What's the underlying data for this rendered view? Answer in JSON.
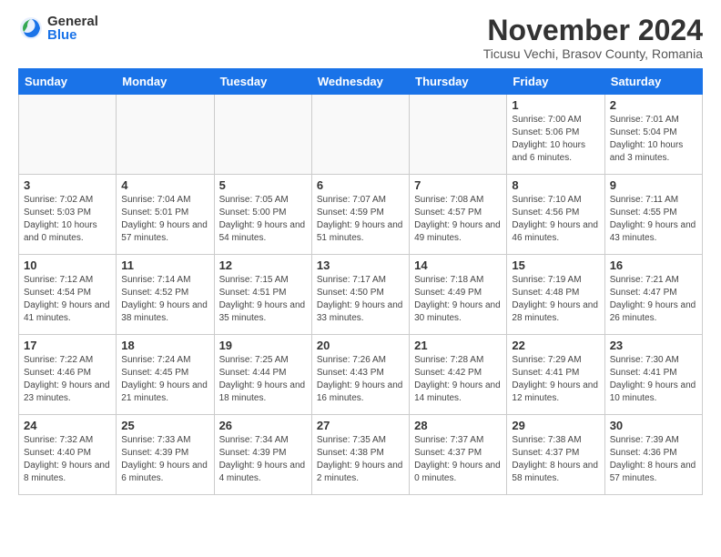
{
  "logo": {
    "general": "General",
    "blue": "Blue"
  },
  "header": {
    "month": "November 2024",
    "location": "Ticusu Vechi, Brasov County, Romania"
  },
  "weekdays": [
    "Sunday",
    "Monday",
    "Tuesday",
    "Wednesday",
    "Thursday",
    "Friday",
    "Saturday"
  ],
  "weeks": [
    [
      {
        "day": "",
        "info": ""
      },
      {
        "day": "",
        "info": ""
      },
      {
        "day": "",
        "info": ""
      },
      {
        "day": "",
        "info": ""
      },
      {
        "day": "",
        "info": ""
      },
      {
        "day": "1",
        "info": "Sunrise: 7:00 AM\nSunset: 5:06 PM\nDaylight: 10 hours and 6 minutes."
      },
      {
        "day": "2",
        "info": "Sunrise: 7:01 AM\nSunset: 5:04 PM\nDaylight: 10 hours and 3 minutes."
      }
    ],
    [
      {
        "day": "3",
        "info": "Sunrise: 7:02 AM\nSunset: 5:03 PM\nDaylight: 10 hours and 0 minutes."
      },
      {
        "day": "4",
        "info": "Sunrise: 7:04 AM\nSunset: 5:01 PM\nDaylight: 9 hours and 57 minutes."
      },
      {
        "day": "5",
        "info": "Sunrise: 7:05 AM\nSunset: 5:00 PM\nDaylight: 9 hours and 54 minutes."
      },
      {
        "day": "6",
        "info": "Sunrise: 7:07 AM\nSunset: 4:59 PM\nDaylight: 9 hours and 51 minutes."
      },
      {
        "day": "7",
        "info": "Sunrise: 7:08 AM\nSunset: 4:57 PM\nDaylight: 9 hours and 49 minutes."
      },
      {
        "day": "8",
        "info": "Sunrise: 7:10 AM\nSunset: 4:56 PM\nDaylight: 9 hours and 46 minutes."
      },
      {
        "day": "9",
        "info": "Sunrise: 7:11 AM\nSunset: 4:55 PM\nDaylight: 9 hours and 43 minutes."
      }
    ],
    [
      {
        "day": "10",
        "info": "Sunrise: 7:12 AM\nSunset: 4:54 PM\nDaylight: 9 hours and 41 minutes."
      },
      {
        "day": "11",
        "info": "Sunrise: 7:14 AM\nSunset: 4:52 PM\nDaylight: 9 hours and 38 minutes."
      },
      {
        "day": "12",
        "info": "Sunrise: 7:15 AM\nSunset: 4:51 PM\nDaylight: 9 hours and 35 minutes."
      },
      {
        "day": "13",
        "info": "Sunrise: 7:17 AM\nSunset: 4:50 PM\nDaylight: 9 hours and 33 minutes."
      },
      {
        "day": "14",
        "info": "Sunrise: 7:18 AM\nSunset: 4:49 PM\nDaylight: 9 hours and 30 minutes."
      },
      {
        "day": "15",
        "info": "Sunrise: 7:19 AM\nSunset: 4:48 PM\nDaylight: 9 hours and 28 minutes."
      },
      {
        "day": "16",
        "info": "Sunrise: 7:21 AM\nSunset: 4:47 PM\nDaylight: 9 hours and 26 minutes."
      }
    ],
    [
      {
        "day": "17",
        "info": "Sunrise: 7:22 AM\nSunset: 4:46 PM\nDaylight: 9 hours and 23 minutes."
      },
      {
        "day": "18",
        "info": "Sunrise: 7:24 AM\nSunset: 4:45 PM\nDaylight: 9 hours and 21 minutes."
      },
      {
        "day": "19",
        "info": "Sunrise: 7:25 AM\nSunset: 4:44 PM\nDaylight: 9 hours and 18 minutes."
      },
      {
        "day": "20",
        "info": "Sunrise: 7:26 AM\nSunset: 4:43 PM\nDaylight: 9 hours and 16 minutes."
      },
      {
        "day": "21",
        "info": "Sunrise: 7:28 AM\nSunset: 4:42 PM\nDaylight: 9 hours and 14 minutes."
      },
      {
        "day": "22",
        "info": "Sunrise: 7:29 AM\nSunset: 4:41 PM\nDaylight: 9 hours and 12 minutes."
      },
      {
        "day": "23",
        "info": "Sunrise: 7:30 AM\nSunset: 4:41 PM\nDaylight: 9 hours and 10 minutes."
      }
    ],
    [
      {
        "day": "24",
        "info": "Sunrise: 7:32 AM\nSunset: 4:40 PM\nDaylight: 9 hours and 8 minutes."
      },
      {
        "day": "25",
        "info": "Sunrise: 7:33 AM\nSunset: 4:39 PM\nDaylight: 9 hours and 6 minutes."
      },
      {
        "day": "26",
        "info": "Sunrise: 7:34 AM\nSunset: 4:39 PM\nDaylight: 9 hours and 4 minutes."
      },
      {
        "day": "27",
        "info": "Sunrise: 7:35 AM\nSunset: 4:38 PM\nDaylight: 9 hours and 2 minutes."
      },
      {
        "day": "28",
        "info": "Sunrise: 7:37 AM\nSunset: 4:37 PM\nDaylight: 9 hours and 0 minutes."
      },
      {
        "day": "29",
        "info": "Sunrise: 7:38 AM\nSunset: 4:37 PM\nDaylight: 8 hours and 58 minutes."
      },
      {
        "day": "30",
        "info": "Sunrise: 7:39 AM\nSunset: 4:36 PM\nDaylight: 8 hours and 57 minutes."
      }
    ]
  ]
}
